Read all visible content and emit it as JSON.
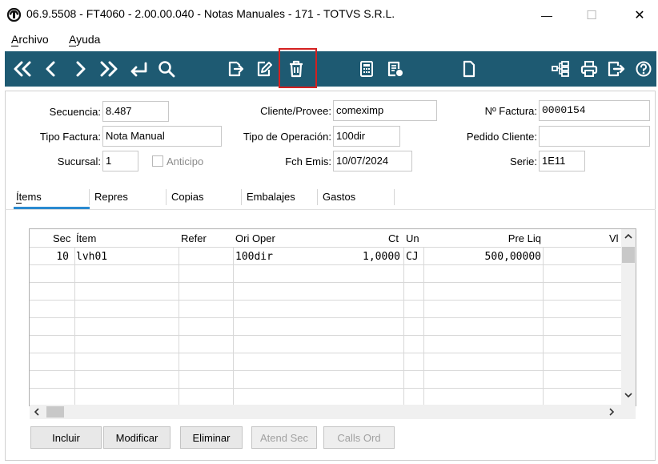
{
  "window": {
    "title": "06.9.5508 - FT4060 - 2.00.00.040 - Notas Manuales - 171 - TOTVS S.R.L.",
    "minimize": "—",
    "maximize": "☐",
    "close": "✕"
  },
  "menu": [
    {
      "label": "Archivo"
    },
    {
      "label": "Ayuda"
    }
  ],
  "toolbar": {
    "icons": [
      "first-icon",
      "previous-icon",
      "next-icon",
      "last-icon",
      "return-icon",
      "search-icon",
      "export-icon",
      "edit-icon",
      "delete-icon",
      "calculator-icon",
      "report-icon",
      "new-document-icon",
      "hierarchy-icon",
      "print-icon",
      "exit-icon",
      "help-icon"
    ],
    "highlight_color": "#d42020",
    "background": "#1e5a72"
  },
  "form": {
    "secuencia": {
      "label": "Secuencia:",
      "value": "8.487"
    },
    "cliente": {
      "label": "Cliente/Provee:",
      "value": "comeximp"
    },
    "factura": {
      "label": "Nº Factura:",
      "value": "0000154"
    },
    "tipo_factura": {
      "label": "Tipo Factura:",
      "value": "Nota Manual"
    },
    "tipo_operacion": {
      "label": "Tipo de Operación:",
      "value": "100dir"
    },
    "pedido_cliente": {
      "label": "Pedido Cliente:",
      "value": ""
    },
    "sucursal": {
      "label": "Sucursal:",
      "value": "1"
    },
    "anticipo": {
      "label": "Anticipo"
    },
    "fch_emis": {
      "label": "Fch Emis:",
      "value": "10/07/2024"
    },
    "serie": {
      "label": "Serie:",
      "value": "1E11"
    }
  },
  "tabs": [
    {
      "label": "Ítems"
    },
    {
      "label": "Repres"
    },
    {
      "label": "Copias"
    },
    {
      "label": "Embalajes"
    },
    {
      "label": "Gastos"
    }
  ],
  "grid": {
    "columns": [
      "Sec",
      "Ítem",
      "Refer",
      "Ori Oper",
      "Ct",
      "Un",
      "Pre Liq",
      "Vl"
    ],
    "rows": [
      {
        "sec": "10",
        "item": "lvh01",
        "refer": "",
        "ori_oper": "100dir",
        "ct": "1,0000",
        "un": "CJ",
        "pre_liq": "500,00000",
        "vl": ""
      }
    ]
  },
  "buttons": [
    {
      "label": "Incluir",
      "enabled": true
    },
    {
      "label": "Modificar",
      "enabled": true
    },
    {
      "label": "Eliminar",
      "enabled": true
    },
    {
      "label": "Atend Sec",
      "enabled": false
    },
    {
      "label": "Calls Ord",
      "enabled": false
    }
  ]
}
